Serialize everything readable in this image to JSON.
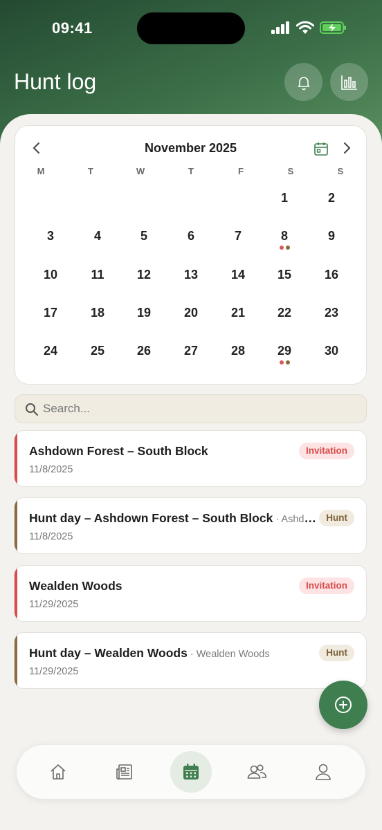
{
  "status_bar": {
    "time": "09:41"
  },
  "header": {
    "title": "Hunt log",
    "icons": [
      "bell-icon",
      "bar-chart-icon"
    ]
  },
  "calendar": {
    "month_label": "November 2025",
    "weekdays": [
      "M",
      "T",
      "W",
      "T",
      "F",
      "S",
      "S"
    ],
    "days": [
      "1",
      "2",
      "3",
      "4",
      "5",
      "6",
      "7",
      "8",
      "9",
      "10",
      "11",
      "12",
      "13",
      "14",
      "15",
      "16",
      "17",
      "18",
      "19",
      "20",
      "21",
      "22",
      "23",
      "24",
      "25",
      "26",
      "27",
      "28",
      "29",
      "30"
    ],
    "marked_days": [
      "8",
      "29"
    ],
    "marker_colors": [
      "#d65a55",
      "#8a6a40"
    ]
  },
  "search": {
    "placeholder": "Search...",
    "value": ""
  },
  "events": [
    {
      "title": "Ashdown Forest – South Block",
      "subtitle": "",
      "date": "11/8/2025",
      "badge": "Invitation",
      "type": "invitation"
    },
    {
      "title": "Hunt day – Ashdown Forest – South Block",
      "subtitle": "Ashdown Forest – South Block",
      "date": "11/8/2025",
      "badge": "Hunt",
      "type": "hunt"
    },
    {
      "title": "Wealden Woods",
      "subtitle": "",
      "date": "11/29/2025",
      "badge": "Invitation",
      "type": "invitation"
    },
    {
      "title": "Hunt day – Wealden Woods",
      "subtitle": "Wealden Woods",
      "date": "11/29/2025",
      "badge": "Hunt",
      "type": "hunt"
    }
  ],
  "tab_bar": {
    "items": [
      "home-icon",
      "news-icon",
      "calendar-icon",
      "people-icon",
      "profile-icon"
    ],
    "active": "calendar-icon"
  },
  "colors": {
    "header_green": "#2f5f3c",
    "accent_green": "#3f7e4f",
    "invitation_red": "#d94b4b",
    "hunt_brown": "#8a6a40"
  }
}
